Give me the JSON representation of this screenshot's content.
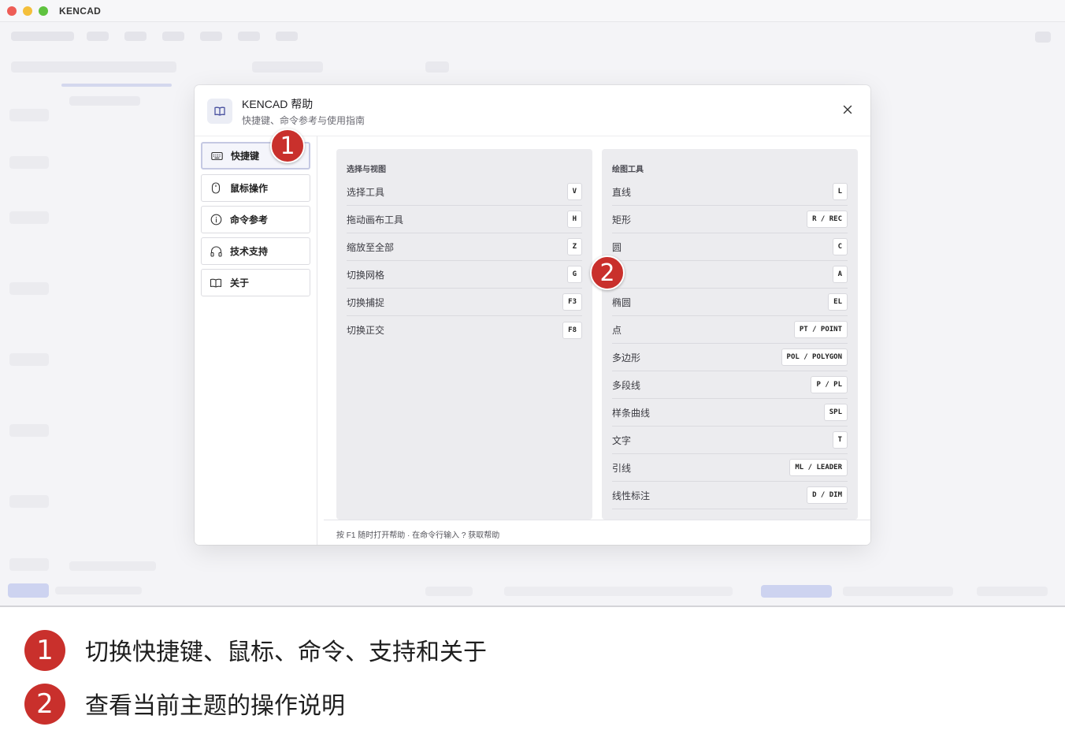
{
  "window": {
    "title": "KENCAD"
  },
  "dialog": {
    "title": "KENCAD 帮助",
    "subtitle": "快捷键、命令参考与使用指南",
    "close_icon": "close-icon",
    "header_icon": "book-icon",
    "nav": [
      {
        "label": "快捷键",
        "icon": "keyboard-icon",
        "active": true
      },
      {
        "label": "鼠标操作",
        "icon": "mouse-icon",
        "active": false
      },
      {
        "label": "命令参考",
        "icon": "info-icon",
        "active": false
      },
      {
        "label": "技术支持",
        "icon": "headphones-icon",
        "active": false
      },
      {
        "label": "关于",
        "icon": "book-icon",
        "active": false
      }
    ],
    "sections": [
      {
        "title": "选择与视图",
        "rows": [
          {
            "label": "选择工具",
            "key": "V"
          },
          {
            "label": "拖动画布工具",
            "key": "H"
          },
          {
            "label": "缩放至全部",
            "key": "Z"
          },
          {
            "label": "切换网格",
            "key": "G"
          },
          {
            "label": "切换捕捉",
            "key": "F3"
          },
          {
            "label": "切换正交",
            "key": "F8"
          }
        ]
      },
      {
        "title": "绘图工具",
        "rows": [
          {
            "label": "直线",
            "key": "L"
          },
          {
            "label": "矩形",
            "key": "R / REC"
          },
          {
            "label": "圆",
            "key": "C"
          },
          {
            "label": "",
            "key": "A"
          },
          {
            "label": "椭圆",
            "key": "EL"
          },
          {
            "label": "点",
            "key": "PT / POINT"
          },
          {
            "label": "多边形",
            "key": "POL / POLYGON"
          },
          {
            "label": "多段线",
            "key": "P / PL"
          },
          {
            "label": "样条曲线",
            "key": "SPL"
          },
          {
            "label": "文字",
            "key": "T"
          },
          {
            "label": "引线",
            "key": "ML / LEADER"
          },
          {
            "label": "线性标注",
            "key": "D / DIM"
          }
        ]
      }
    ],
    "footer": "按 F1 随时打开帮助 · 在命令行输入 ? 获取帮助"
  },
  "annotations": [
    {
      "number": "1",
      "text": "切换快捷键、鼠标、命令、支持和关于"
    },
    {
      "number": "2",
      "text": "查看当前主题的操作说明"
    }
  ],
  "colors": {
    "marker": "#c9302c",
    "accent_border": "#c5c9e3"
  }
}
